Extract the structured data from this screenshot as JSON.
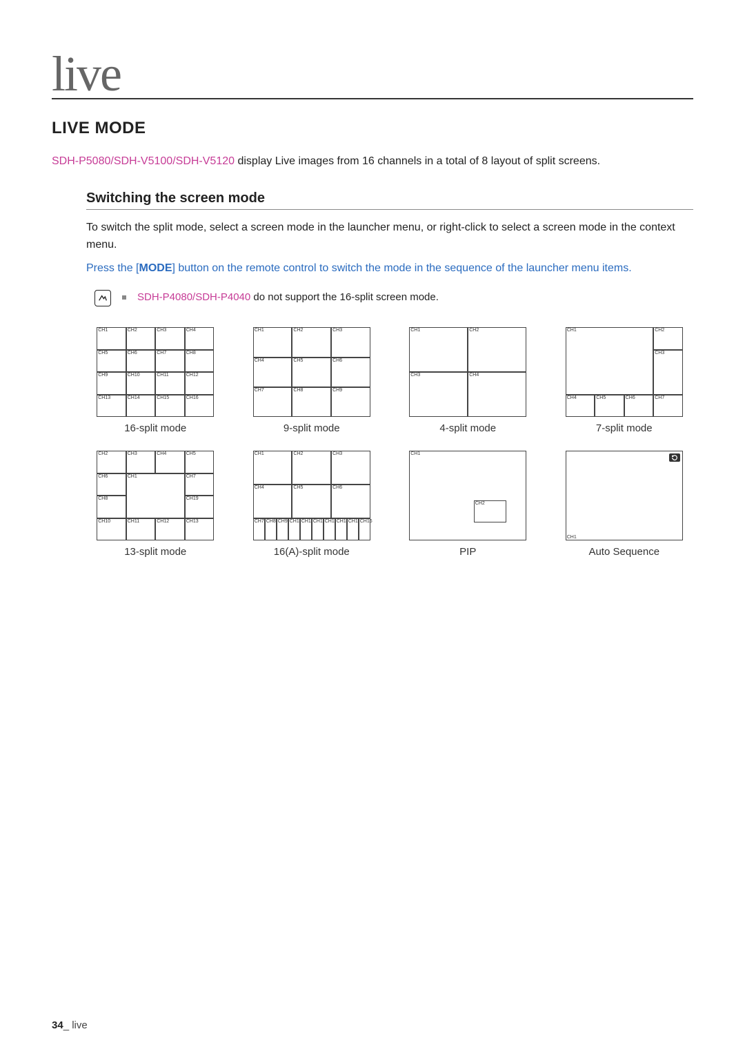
{
  "brand": "live",
  "section_title": "LIVE MODE",
  "intro_models": "SDH-P5080/SDH-V5100/SDH-V5120",
  "intro_rest": " display Live images from 16 channels in a total of 8 layout of split screens.",
  "sub_title": "Switching the screen mode",
  "body1": "To switch the split mode, select a screen mode in the launcher menu, or right-click to select a screen mode in the context menu.",
  "body2_pre": "Press the [",
  "body2_mode": "MODE",
  "body2_post": "] button on the remote control to switch the mode in the sequence of the launcher menu items.",
  "note_models": "SDH-P4080/SDH-P4040",
  "note_rest": " do not support the 16-split screen mode.",
  "captions": {
    "c0": "16-split mode",
    "c1": "9-split mode",
    "c2": "4-split mode",
    "c3": "7-split mode",
    "c4": "13-split mode",
    "c5": "16(A)-split mode",
    "c6": "PIP",
    "c7": "Auto Sequence"
  },
  "ch": {
    "1": "CH1",
    "2": "CH2",
    "3": "CH3",
    "4": "CH4",
    "5": "CH5",
    "6": "CH6",
    "7": "CH7",
    "8": "CH8",
    "9": "CH9",
    "10": "CH10",
    "11": "CH11",
    "12": "CH12",
    "13": "CH13",
    "14": "CH14",
    "15": "CH15",
    "16": "CH16",
    "19": "CH19"
  },
  "footer": {
    "page": "34",
    "sep": "_ ",
    "section": "live"
  }
}
